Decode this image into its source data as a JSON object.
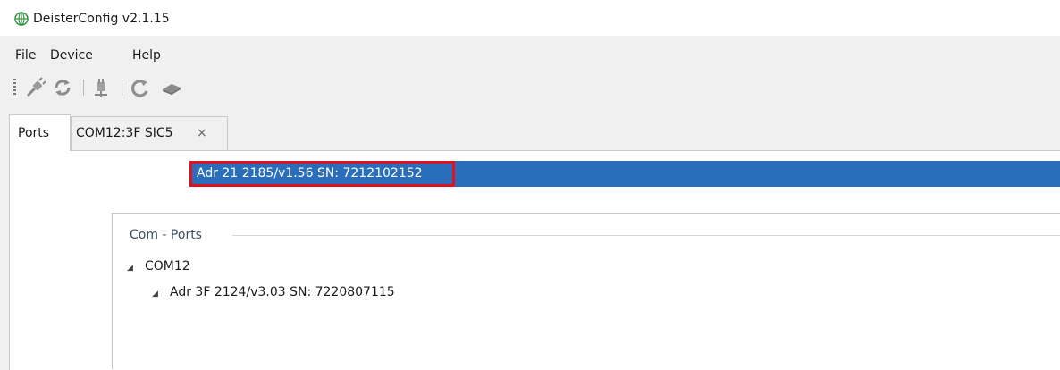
{
  "window": {
    "title": "DeisterConfig v2.1.15",
    "icon": "green-globe-icon"
  },
  "menu": [
    "File",
    "Device",
    "Help"
  ],
  "toolbar": {
    "buttons": [
      "connect-plug-icon",
      "refresh-icon",
      "network-plug-icon",
      "reconnect-arrow-icon",
      "device-reader-icon"
    ]
  },
  "tabs": [
    {
      "label": "Ports",
      "active": true
    },
    {
      "label": "COM12:3F SIC5",
      "active": false,
      "close": "×"
    }
  ],
  "ports_panel": {
    "group_title": "Com - Ports",
    "tree": [
      {
        "label": "COM12",
        "expanded": true,
        "toggle": "◢"
      },
      {
        "label": "Adr 3F 2124/v3.03 SN: 7220807115",
        "expanded": true,
        "toggle": "◢"
      },
      {
        "label": "Adr 21 2185/v1.56 SN: 7212102152",
        "selected": true
      }
    ]
  },
  "colors": {
    "selection": "#2a6ebb",
    "highlight_box": "#e0101c",
    "group_title": "#3b4d66"
  }
}
